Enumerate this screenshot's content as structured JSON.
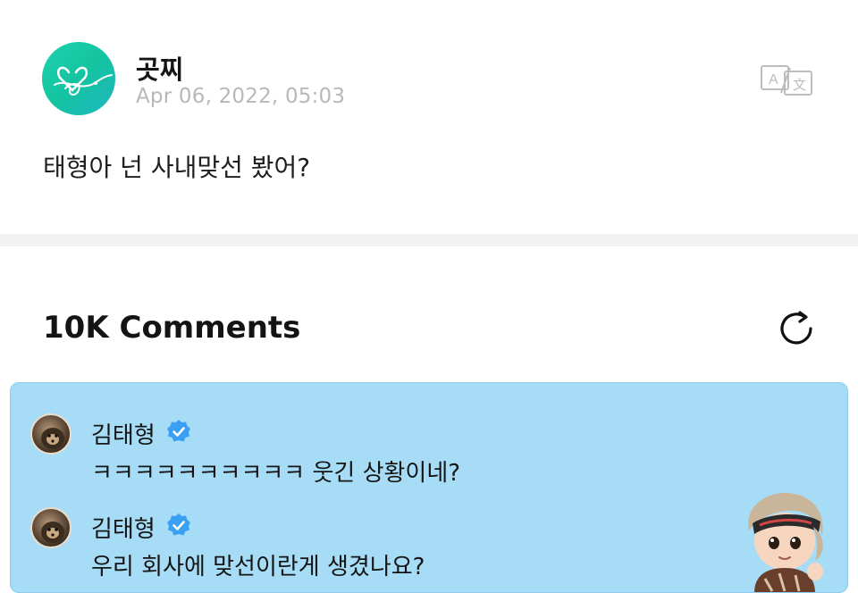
{
  "post": {
    "author": "곳찌",
    "date": "Apr 06, 2022, 05:03",
    "text": "태형아 넌 사내맞선 봤어?",
    "translate_icon": "translate-icon"
  },
  "comments_section": {
    "title": "10K Comments",
    "refresh_icon": "refresh-icon"
  },
  "comments": [
    {
      "name": "김태형",
      "verified": true,
      "text": "ㅋㅋㅋㅋㅋㅋㅋㅋㅋㅋ 웃긴 상황이네?"
    },
    {
      "name": "김태형",
      "verified": true,
      "text": "우리 회사에 맞선이란게 생겼나요?"
    }
  ],
  "colors": {
    "accent_teal": "#1fd1b0",
    "highlight_box": "#a6dcf6",
    "verified_blue": "#3b9ff2",
    "date_gray": "#b8b8b8"
  }
}
